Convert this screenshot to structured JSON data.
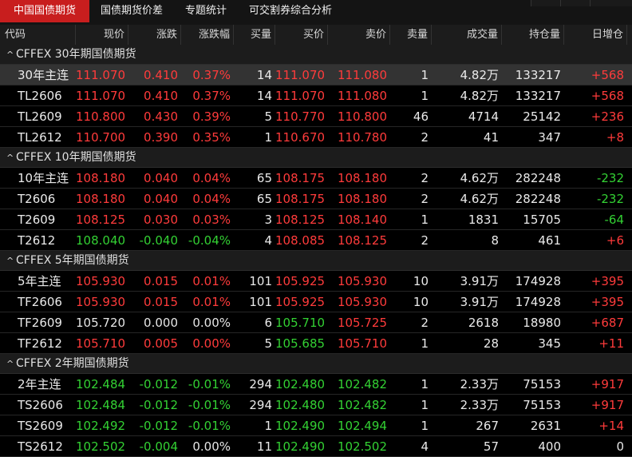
{
  "tabs": [
    "中国国债期货",
    "国债期货价差",
    "专题统计",
    "可交割券综合分析"
  ],
  "active_tab": 0,
  "columns": [
    "代码",
    "现价",
    "涨跌",
    "涨跌幅",
    "买量",
    "买价",
    "卖价",
    "卖量",
    "成交量",
    "持仓量",
    "日增仓"
  ],
  "colors": {
    "up": "#ff3b3b",
    "down": "#33d133",
    "active_tab": "#c81e1e"
  },
  "groups": [
    {
      "title": "CFFEX 30年期国债期货",
      "rows": [
        {
          "code": "30年主连",
          "price": "111.070",
          "chg": "0.410",
          "pct": "0.37%",
          "bidv": "14",
          "bid": "111.070",
          "ask": "111.080",
          "askv": "1",
          "vol": "4.82万",
          "oi": "133217",
          "oichg": "+568",
          "dir": "up",
          "selected": true,
          "bid_dir": "up",
          "ask_dir": "up",
          "oi_dir": "up"
        },
        {
          "code": "TL2606",
          "price": "111.070",
          "chg": "0.410",
          "pct": "0.37%",
          "bidv": "14",
          "bid": "111.070",
          "ask": "111.080",
          "askv": "1",
          "vol": "4.82万",
          "oi": "133217",
          "oichg": "+568",
          "dir": "up",
          "bid_dir": "up",
          "ask_dir": "up",
          "oi_dir": "up"
        },
        {
          "code": "TL2609",
          "price": "110.800",
          "chg": "0.430",
          "pct": "0.39%",
          "bidv": "5",
          "bid": "110.770",
          "ask": "110.800",
          "askv": "46",
          "vol": "4714",
          "oi": "25142",
          "oichg": "+236",
          "dir": "up",
          "bid_dir": "up",
          "ask_dir": "up",
          "oi_dir": "up"
        },
        {
          "code": "TL2612",
          "price": "110.700",
          "chg": "0.390",
          "pct": "0.35%",
          "bidv": "1",
          "bid": "110.670",
          "ask": "110.780",
          "askv": "2",
          "vol": "41",
          "oi": "347",
          "oichg": "+8",
          "dir": "up",
          "bid_dir": "up",
          "ask_dir": "up",
          "oi_dir": "up"
        }
      ]
    },
    {
      "title": "CFFEX 10年期国债期货",
      "rows": [
        {
          "code": "10年主连",
          "price": "108.180",
          "chg": "0.040",
          "pct": "0.04%",
          "bidv": "65",
          "bid": "108.175",
          "ask": "108.180",
          "askv": "2",
          "vol": "4.62万",
          "oi": "282248",
          "oichg": "-232",
          "dir": "up",
          "bid_dir": "up",
          "ask_dir": "up",
          "oi_dir": "down"
        },
        {
          "code": "T2606",
          "price": "108.180",
          "chg": "0.040",
          "pct": "0.04%",
          "bidv": "65",
          "bid": "108.175",
          "ask": "108.180",
          "askv": "2",
          "vol": "4.62万",
          "oi": "282248",
          "oichg": "-232",
          "dir": "up",
          "bid_dir": "up",
          "ask_dir": "up",
          "oi_dir": "down"
        },
        {
          "code": "T2609",
          "price": "108.125",
          "chg": "0.030",
          "pct": "0.03%",
          "bidv": "3",
          "bid": "108.125",
          "ask": "108.140",
          "askv": "1",
          "vol": "1831",
          "oi": "15705",
          "oichg": "-64",
          "dir": "up",
          "bid_dir": "up",
          "ask_dir": "up",
          "oi_dir": "down"
        },
        {
          "code": "T2612",
          "price": "108.040",
          "chg": "-0.040",
          "pct": "-0.04%",
          "bidv": "4",
          "bid": "108.085",
          "ask": "108.125",
          "askv": "2",
          "vol": "8",
          "oi": "461",
          "oichg": "+6",
          "dir": "down",
          "bid_dir": "up",
          "ask_dir": "up",
          "oi_dir": "up"
        }
      ]
    },
    {
      "title": "CFFEX 5年期国债期货",
      "rows": [
        {
          "code": "5年主连",
          "price": "105.930",
          "chg": "0.015",
          "pct": "0.01%",
          "bidv": "101",
          "bid": "105.925",
          "ask": "105.930",
          "askv": "10",
          "vol": "3.91万",
          "oi": "174928",
          "oichg": "+395",
          "dir": "up",
          "bid_dir": "up",
          "ask_dir": "up",
          "oi_dir": "up"
        },
        {
          "code": "TF2606",
          "price": "105.930",
          "chg": "0.015",
          "pct": "0.01%",
          "bidv": "101",
          "bid": "105.925",
          "ask": "105.930",
          "askv": "10",
          "vol": "3.91万",
          "oi": "174928",
          "oichg": "+395",
          "dir": "up",
          "bid_dir": "up",
          "ask_dir": "up",
          "oi_dir": "up"
        },
        {
          "code": "TF2609",
          "price": "105.720",
          "chg": "0.000",
          "pct": "0.00%",
          "bidv": "6",
          "bid": "105.710",
          "ask": "105.725",
          "askv": "2",
          "vol": "2618",
          "oi": "18980",
          "oichg": "+687",
          "dir": "flat",
          "bid_dir": "down",
          "ask_dir": "up",
          "oi_dir": "up"
        },
        {
          "code": "TF2612",
          "price": "105.710",
          "chg": "0.005",
          "pct": "0.00%",
          "bidv": "5",
          "bid": "105.685",
          "ask": "105.710",
          "askv": "1",
          "vol": "28",
          "oi": "345",
          "oichg": "+11",
          "dir": "up",
          "bid_dir": "down",
          "ask_dir": "up",
          "oi_dir": "up"
        }
      ]
    },
    {
      "title": "CFFEX 2年期国债期货",
      "rows": [
        {
          "code": "2年主连",
          "price": "102.484",
          "chg": "-0.012",
          "pct": "-0.01%",
          "bidv": "294",
          "bid": "102.480",
          "ask": "102.482",
          "askv": "1",
          "vol": "2.33万",
          "oi": "75153",
          "oichg": "+917",
          "dir": "down",
          "bid_dir": "down",
          "ask_dir": "down",
          "oi_dir": "up"
        },
        {
          "code": "TS2606",
          "price": "102.484",
          "chg": "-0.012",
          "pct": "-0.01%",
          "bidv": "294",
          "bid": "102.480",
          "ask": "102.482",
          "askv": "1",
          "vol": "2.33万",
          "oi": "75153",
          "oichg": "+917",
          "dir": "down",
          "bid_dir": "down",
          "ask_dir": "down",
          "oi_dir": "up"
        },
        {
          "code": "TS2609",
          "price": "102.492",
          "chg": "-0.012",
          "pct": "-0.01%",
          "bidv": "1",
          "bid": "102.490",
          "ask": "102.494",
          "askv": "1",
          "vol": "267",
          "oi": "2631",
          "oichg": "+14",
          "dir": "down",
          "bid_dir": "down",
          "ask_dir": "down",
          "oi_dir": "up"
        },
        {
          "code": "TS2612",
          "price": "102.502",
          "chg": "-0.004",
          "pct": "0.00%",
          "bidv": "11",
          "bid": "102.490",
          "ask": "102.502",
          "askv": "4",
          "vol": "57",
          "oi": "400",
          "oichg": "0",
          "dir": "down",
          "bid_dir": "down",
          "ask_dir": "down",
          "oi_dir": "flat",
          "pct_dir": "flat"
        }
      ]
    }
  ]
}
